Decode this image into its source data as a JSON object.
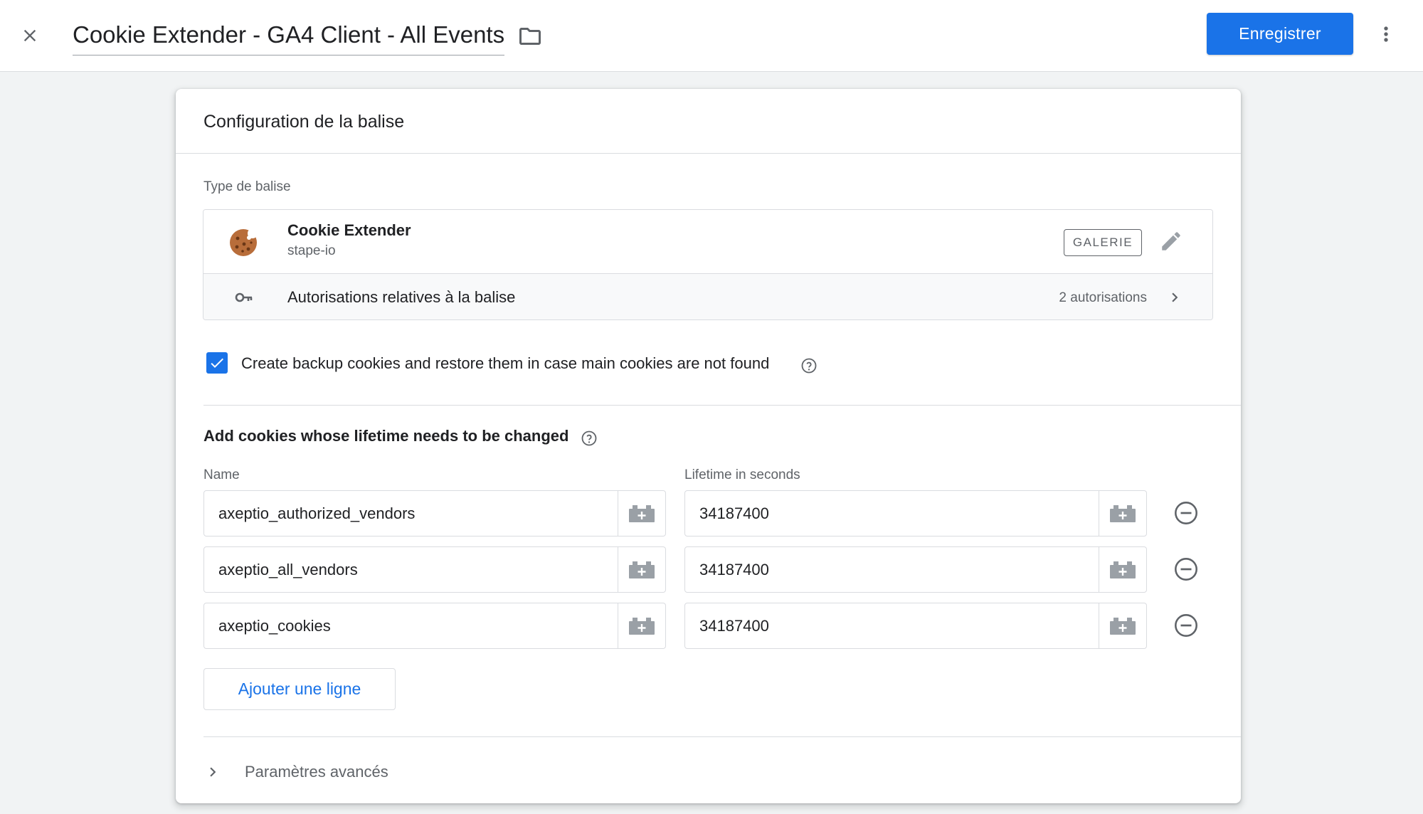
{
  "header": {
    "title": "Cookie Extender - GA4 Client - All Events",
    "save_label": "Enregistrer",
    "icons": {
      "close": "close-icon",
      "folder": "folder-icon",
      "more": "more-vert-icon"
    }
  },
  "card": {
    "title": "Configuration de la balise",
    "tag_type_label": "Type de balise",
    "tag": {
      "name": "Cookie Extender",
      "vendor": "stape-io",
      "gallery_badge": "GALERIE",
      "icon": "cookie-icon"
    },
    "permissions": {
      "label": "Autorisations relatives à la balise",
      "count": "2 autorisations"
    },
    "backup_checkbox": {
      "label": "Create backup cookies and restore them in case main cookies are not found",
      "checked": true
    },
    "cookies_section": {
      "heading": "Add cookies whose lifetime needs to be changed",
      "col_name": "Name",
      "col_lifetime": "Lifetime in seconds",
      "rows": [
        {
          "name": "axeptio_authorized_vendors",
          "lifetime": "34187400"
        },
        {
          "name": "axeptio_all_vendors",
          "lifetime": "34187400"
        },
        {
          "name": "axeptio_cookies",
          "lifetime": "34187400"
        }
      ],
      "add_row_label": "Ajouter une ligne"
    },
    "advanced_label": "Paramètres avancés"
  },
  "colors": {
    "accent": "#1a73e8",
    "text_primary": "#202124",
    "text_secondary": "#5f6368",
    "divider": "#dadce0",
    "background": "#f1f3f4"
  }
}
